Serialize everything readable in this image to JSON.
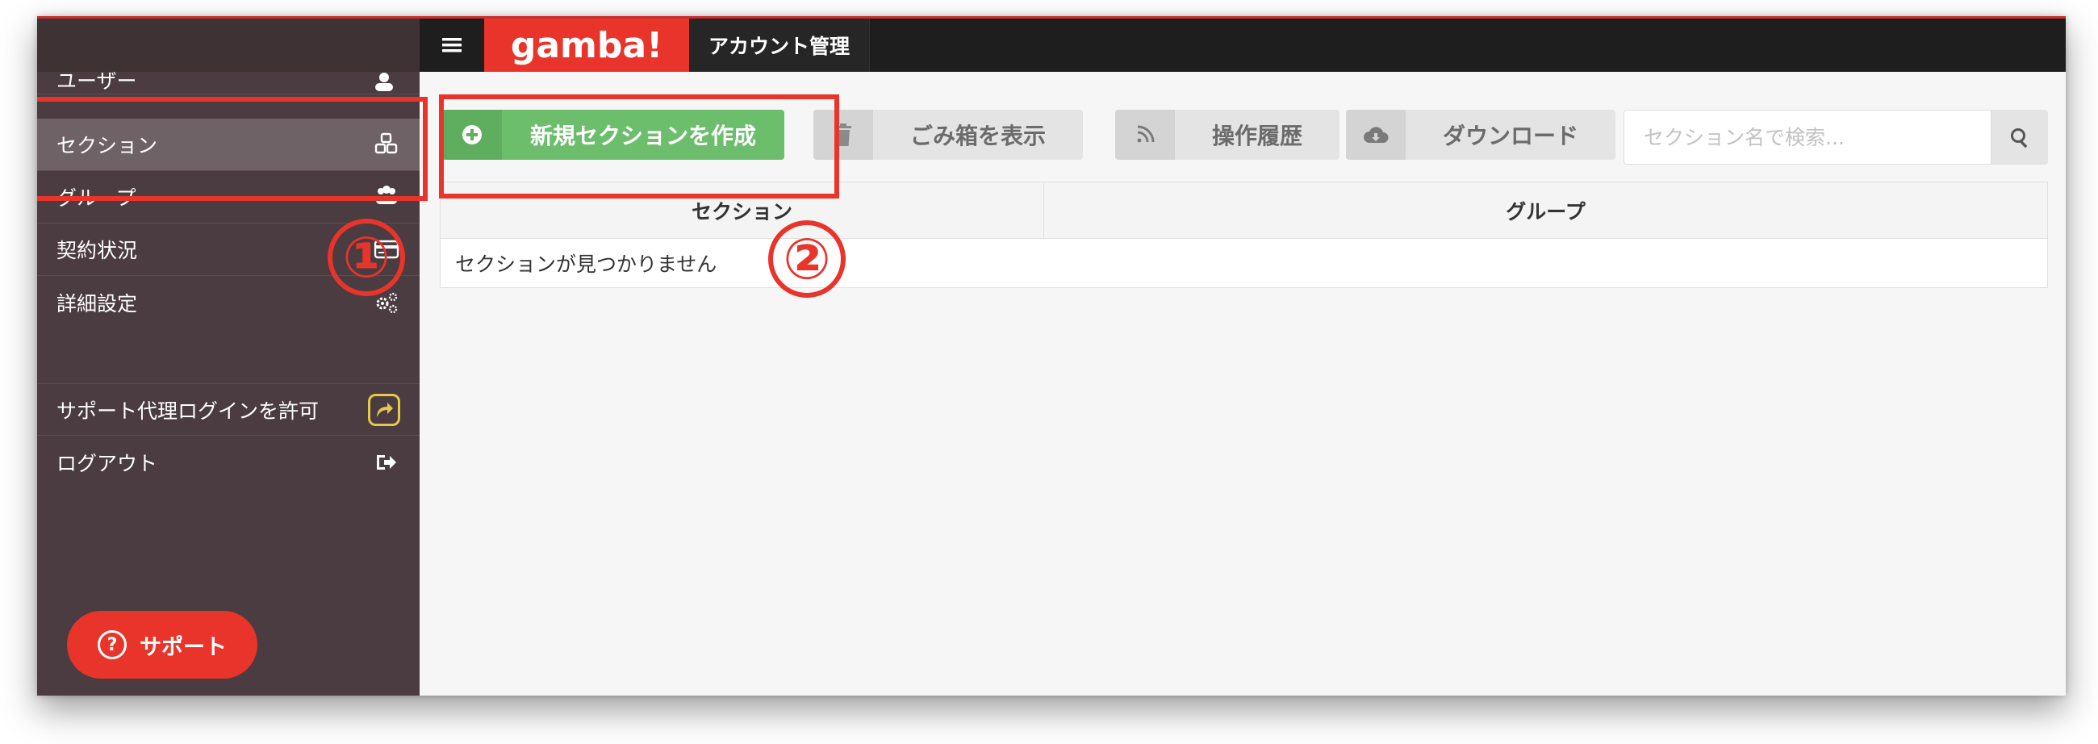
{
  "header": {
    "logo": "gamba!",
    "title": "アカウント管理"
  },
  "sidebar": {
    "items": [
      {
        "label": "ユーザー",
        "icon": "user-add-icon"
      },
      {
        "label": "セクション",
        "icon": "cubes-icon",
        "active": true
      },
      {
        "label": "グループ",
        "icon": "users-icon"
      },
      {
        "label": "契約状況",
        "icon": "credit-card-icon"
      },
      {
        "label": "詳細設定",
        "icon": "gears-icon"
      },
      {
        "label": "サポート代理ログインを許可",
        "icon": "share-icon"
      },
      {
        "label": "ログアウト",
        "icon": "sign-out-icon"
      }
    ],
    "support_label": "サポート"
  },
  "toolbar": {
    "create_label": "新規セクションを作成",
    "trash_label": "ごみ箱を表示",
    "history_label": "操作履歴",
    "download_label": "ダウンロード"
  },
  "search": {
    "placeholder": "セクション名で検索...",
    "value": ""
  },
  "table": {
    "columns": [
      "セクション",
      "グループ"
    ],
    "empty_message": "セクションが見つかりません"
  },
  "annotations": {
    "one": "①",
    "two": "②"
  },
  "colors": {
    "accent": "#e8342a",
    "success": "#6cbd6c",
    "sidebar": "#4a3c40",
    "header": "#1e1e1e"
  }
}
